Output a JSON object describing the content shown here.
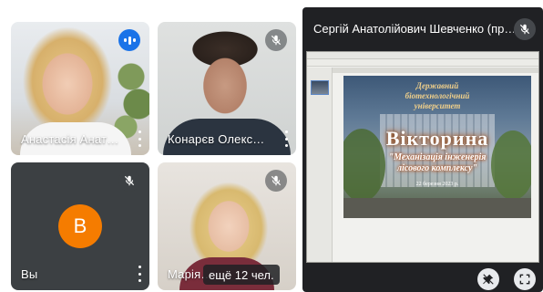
{
  "tiles": [
    {
      "name": "Анастасія Анат…",
      "mic": "speaking"
    },
    {
      "name": "Конарєв Олекс…",
      "mic": "muted"
    },
    {
      "name": "Вы",
      "mic": "muted",
      "avatar_letter": "В"
    },
    {
      "name": "Марія…",
      "mic": "muted",
      "more_label": "ещё 12 чел."
    }
  ],
  "presenter": {
    "name": "Сергій Анатолійович Шевченко (пр…"
  },
  "slide": {
    "institution": "Державний біотехнологічний університет",
    "title": "Вікторина",
    "subtitle": "\"Механізація інженерія лісового комплексу\"",
    "date": "22 березня 2023 р."
  },
  "colors": {
    "speaking": "#1a73e8",
    "avatar": "#f57c00",
    "panel_bg": "#202124"
  },
  "icons": {
    "muted": "mic-off-icon",
    "speaking": "audio-level-icon",
    "menu": "more-vert-icon",
    "pin": "pin-off-icon",
    "fullscreen": "fullscreen-icon"
  }
}
